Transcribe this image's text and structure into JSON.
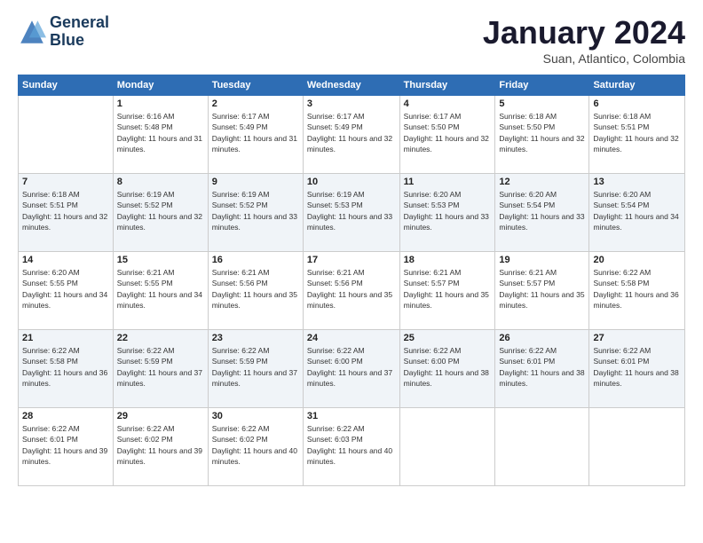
{
  "logo": {
    "line1": "General",
    "line2": "Blue"
  },
  "header": {
    "title": "January 2024",
    "subtitle": "Suan, Atlantico, Colombia"
  },
  "days_of_week": [
    "Sunday",
    "Monday",
    "Tuesday",
    "Wednesday",
    "Thursday",
    "Friday",
    "Saturday"
  ],
  "weeks": [
    [
      {
        "day": "",
        "sunrise": "",
        "sunset": "",
        "daylight": ""
      },
      {
        "day": "1",
        "sunrise": "Sunrise: 6:16 AM",
        "sunset": "Sunset: 5:48 PM",
        "daylight": "Daylight: 11 hours and 31 minutes."
      },
      {
        "day": "2",
        "sunrise": "Sunrise: 6:17 AM",
        "sunset": "Sunset: 5:49 PM",
        "daylight": "Daylight: 11 hours and 31 minutes."
      },
      {
        "day": "3",
        "sunrise": "Sunrise: 6:17 AM",
        "sunset": "Sunset: 5:49 PM",
        "daylight": "Daylight: 11 hours and 32 minutes."
      },
      {
        "day": "4",
        "sunrise": "Sunrise: 6:17 AM",
        "sunset": "Sunset: 5:50 PM",
        "daylight": "Daylight: 11 hours and 32 minutes."
      },
      {
        "day": "5",
        "sunrise": "Sunrise: 6:18 AM",
        "sunset": "Sunset: 5:50 PM",
        "daylight": "Daylight: 11 hours and 32 minutes."
      },
      {
        "day": "6",
        "sunrise": "Sunrise: 6:18 AM",
        "sunset": "Sunset: 5:51 PM",
        "daylight": "Daylight: 11 hours and 32 minutes."
      }
    ],
    [
      {
        "day": "7",
        "sunrise": "Sunrise: 6:18 AM",
        "sunset": "Sunset: 5:51 PM",
        "daylight": "Daylight: 11 hours and 32 minutes."
      },
      {
        "day": "8",
        "sunrise": "Sunrise: 6:19 AM",
        "sunset": "Sunset: 5:52 PM",
        "daylight": "Daylight: 11 hours and 32 minutes."
      },
      {
        "day": "9",
        "sunrise": "Sunrise: 6:19 AM",
        "sunset": "Sunset: 5:52 PM",
        "daylight": "Daylight: 11 hours and 33 minutes."
      },
      {
        "day": "10",
        "sunrise": "Sunrise: 6:19 AM",
        "sunset": "Sunset: 5:53 PM",
        "daylight": "Daylight: 11 hours and 33 minutes."
      },
      {
        "day": "11",
        "sunrise": "Sunrise: 6:20 AM",
        "sunset": "Sunset: 5:53 PM",
        "daylight": "Daylight: 11 hours and 33 minutes."
      },
      {
        "day": "12",
        "sunrise": "Sunrise: 6:20 AM",
        "sunset": "Sunset: 5:54 PM",
        "daylight": "Daylight: 11 hours and 33 minutes."
      },
      {
        "day": "13",
        "sunrise": "Sunrise: 6:20 AM",
        "sunset": "Sunset: 5:54 PM",
        "daylight": "Daylight: 11 hours and 34 minutes."
      }
    ],
    [
      {
        "day": "14",
        "sunrise": "Sunrise: 6:20 AM",
        "sunset": "Sunset: 5:55 PM",
        "daylight": "Daylight: 11 hours and 34 minutes."
      },
      {
        "day": "15",
        "sunrise": "Sunrise: 6:21 AM",
        "sunset": "Sunset: 5:55 PM",
        "daylight": "Daylight: 11 hours and 34 minutes."
      },
      {
        "day": "16",
        "sunrise": "Sunrise: 6:21 AM",
        "sunset": "Sunset: 5:56 PM",
        "daylight": "Daylight: 11 hours and 35 minutes."
      },
      {
        "day": "17",
        "sunrise": "Sunrise: 6:21 AM",
        "sunset": "Sunset: 5:56 PM",
        "daylight": "Daylight: 11 hours and 35 minutes."
      },
      {
        "day": "18",
        "sunrise": "Sunrise: 6:21 AM",
        "sunset": "Sunset: 5:57 PM",
        "daylight": "Daylight: 11 hours and 35 minutes."
      },
      {
        "day": "19",
        "sunrise": "Sunrise: 6:21 AM",
        "sunset": "Sunset: 5:57 PM",
        "daylight": "Daylight: 11 hours and 35 minutes."
      },
      {
        "day": "20",
        "sunrise": "Sunrise: 6:22 AM",
        "sunset": "Sunset: 5:58 PM",
        "daylight": "Daylight: 11 hours and 36 minutes."
      }
    ],
    [
      {
        "day": "21",
        "sunrise": "Sunrise: 6:22 AM",
        "sunset": "Sunset: 5:58 PM",
        "daylight": "Daylight: 11 hours and 36 minutes."
      },
      {
        "day": "22",
        "sunrise": "Sunrise: 6:22 AM",
        "sunset": "Sunset: 5:59 PM",
        "daylight": "Daylight: 11 hours and 37 minutes."
      },
      {
        "day": "23",
        "sunrise": "Sunrise: 6:22 AM",
        "sunset": "Sunset: 5:59 PM",
        "daylight": "Daylight: 11 hours and 37 minutes."
      },
      {
        "day": "24",
        "sunrise": "Sunrise: 6:22 AM",
        "sunset": "Sunset: 6:00 PM",
        "daylight": "Daylight: 11 hours and 37 minutes."
      },
      {
        "day": "25",
        "sunrise": "Sunrise: 6:22 AM",
        "sunset": "Sunset: 6:00 PM",
        "daylight": "Daylight: 11 hours and 38 minutes."
      },
      {
        "day": "26",
        "sunrise": "Sunrise: 6:22 AM",
        "sunset": "Sunset: 6:01 PM",
        "daylight": "Daylight: 11 hours and 38 minutes."
      },
      {
        "day": "27",
        "sunrise": "Sunrise: 6:22 AM",
        "sunset": "Sunset: 6:01 PM",
        "daylight": "Daylight: 11 hours and 38 minutes."
      }
    ],
    [
      {
        "day": "28",
        "sunrise": "Sunrise: 6:22 AM",
        "sunset": "Sunset: 6:01 PM",
        "daylight": "Daylight: 11 hours and 39 minutes."
      },
      {
        "day": "29",
        "sunrise": "Sunrise: 6:22 AM",
        "sunset": "Sunset: 6:02 PM",
        "daylight": "Daylight: 11 hours and 39 minutes."
      },
      {
        "day": "30",
        "sunrise": "Sunrise: 6:22 AM",
        "sunset": "Sunset: 6:02 PM",
        "daylight": "Daylight: 11 hours and 40 minutes."
      },
      {
        "day": "31",
        "sunrise": "Sunrise: 6:22 AM",
        "sunset": "Sunset: 6:03 PM",
        "daylight": "Daylight: 11 hours and 40 minutes."
      },
      {
        "day": "",
        "sunrise": "",
        "sunset": "",
        "daylight": ""
      },
      {
        "day": "",
        "sunrise": "",
        "sunset": "",
        "daylight": ""
      },
      {
        "day": "",
        "sunrise": "",
        "sunset": "",
        "daylight": ""
      }
    ]
  ]
}
